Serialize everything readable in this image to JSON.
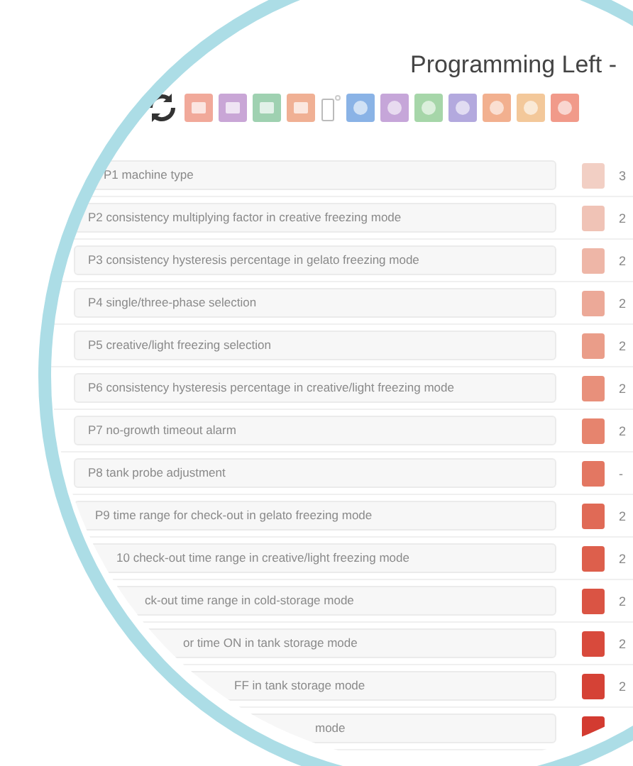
{
  "title": "Programming Left -",
  "rows": [
    {
      "label": "P1 machine type",
      "color": "#f2cfc4",
      "value": "3"
    },
    {
      "label": "P2 consistency multiplying factor in creative freezing mode",
      "color": "#f0c3b6",
      "value": "2"
    },
    {
      "label": "P3 consistency hysteresis percentage in gelato freezing mode",
      "color": "#eeb6a7",
      "value": "2"
    },
    {
      "label": "P4 single/three-phase selection",
      "color": "#eca998",
      "value": "2"
    },
    {
      "label": "P5 creative/light freezing selection",
      "color": "#ea9d89",
      "value": "2"
    },
    {
      "label": "P6 consistency hysteresis percentage in creative/light freezing mode",
      "color": "#e8907b",
      "value": "2"
    },
    {
      "label": "P7 no-growth timeout alarm",
      "color": "#e6846e",
      "value": "2"
    },
    {
      "label": "P8 tank probe adjustment",
      "color": "#e37762",
      "value": "-"
    },
    {
      "label": "P9 time range for check-out in gelato freezing mode",
      "color": "#e06a56",
      "value": "2"
    },
    {
      "label": "10 check-out time range in creative/light freezing mode",
      "color": "#dd5f4c",
      "value": "2"
    },
    {
      "label": "ck-out time range in cold-storage mode",
      "color": "#da5444",
      "value": "2"
    },
    {
      "label": "or time ON in tank storage mode",
      "color": "#d84a3c",
      "value": "2"
    },
    {
      "label": "FF in tank storage mode",
      "color": "#d54236",
      "value": "2"
    },
    {
      "label": "mode",
      "color": "#d33b31"
    }
  ]
}
